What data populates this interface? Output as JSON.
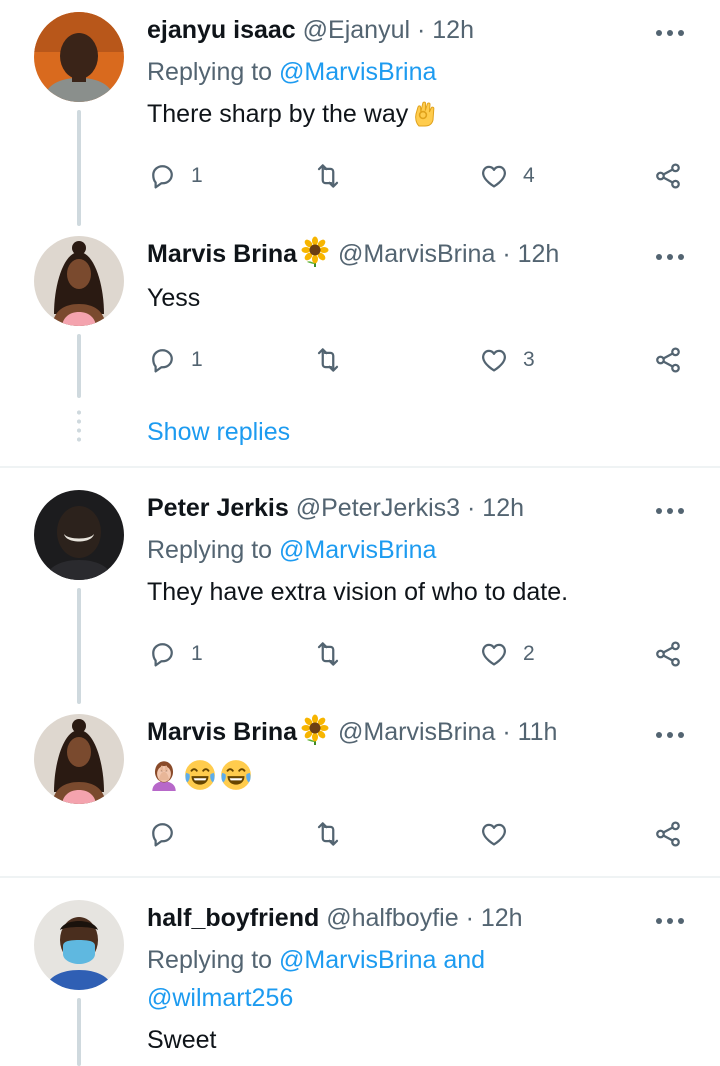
{
  "tweets": [
    {
      "name": "ejanyu isaac",
      "handle": "@Ejanyul",
      "time": "12h",
      "replying_prefix": "Replying to",
      "replying_to": "@MarvisBrina",
      "text": "There sharp by the way",
      "text_emoji": "ok-hand-emoji",
      "replies": "1",
      "retweets": "",
      "likes": "4"
    },
    {
      "name": "Marvis Brina",
      "name_emoji": "sunflower-emoji",
      "handle": "@MarvisBrina",
      "time": "12h",
      "text": "Yess",
      "replies": "1",
      "retweets": "",
      "likes": "3",
      "show_replies": "Show replies"
    },
    {
      "name": "Peter Jerkis",
      "handle": "@PeterJerkis3",
      "time": "12h",
      "replying_prefix": "Replying to",
      "replying_to": "@MarvisBrina",
      "text": "They have extra vision of who to date.",
      "replies": "1",
      "retweets": "",
      "likes": "2"
    },
    {
      "name": "Marvis Brina",
      "name_emoji": "sunflower-emoji",
      "handle": "@MarvisBrina",
      "time": "11h",
      "emojis": [
        "person-facepalming-emoji",
        "face-with-tears-of-joy-emoji",
        "face-with-tears-of-joy-emoji"
      ],
      "replies": "",
      "retweets": "",
      "likes": ""
    },
    {
      "name": "half_boyfriend",
      "handle": "@halfboyfie",
      "time": "12h",
      "replying_prefix": "Replying to",
      "replying_to": "@MarvisBrina",
      "replying_and": "and",
      "replying_to_2": "@wilmart256",
      "text": "Sweet"
    }
  ],
  "separator": "·",
  "colors": {
    "text_primary": "#0f1419",
    "text_secondary": "#536471",
    "link": "#1d9bf0",
    "thread_line": "#cfd9de",
    "divider": "#eff3f4"
  },
  "icons": {
    "reply": "reply-icon",
    "retweet": "retweet-icon",
    "like": "heart-icon",
    "share": "share-icon",
    "more": "more-icon"
  }
}
